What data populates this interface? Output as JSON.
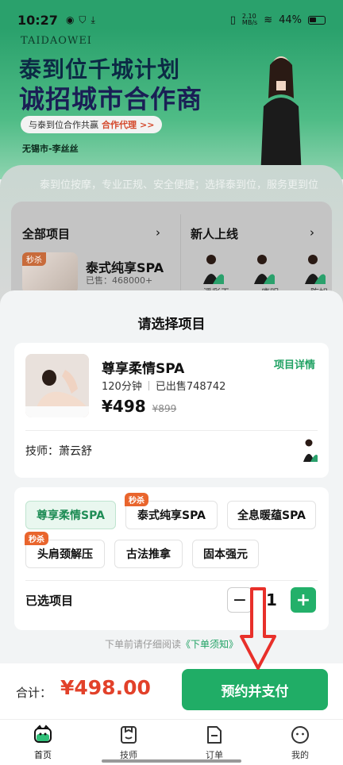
{
  "status": {
    "time": "10:27",
    "net_speed": "2.10\nMB/s",
    "battery": "44%"
  },
  "banner": {
    "brand": "TAIDAOWEI",
    "headline1": "泰到位千城计划",
    "headline2": "诚招城市合作商",
    "pill_text": "与泰到位合作共赢",
    "pill_link": "合作代理",
    "pill_chev": ">>",
    "city": "无锡市-李丝丝"
  },
  "marquee": "泰到位按摩，专业正规、安全便捷；选择泰到位，服务更到位",
  "categories": {
    "all_label": "全部项目",
    "new_label": "新人上线",
    "arrow": "›",
    "featured": {
      "badge": "秒杀",
      "title": "泰式纯享SPA",
      "sold": "已售：468000+"
    },
    "tech_names": [
      "潘彩玉",
      "唐明",
      "陈旭"
    ]
  },
  "sheet": {
    "title": "请选择项目",
    "product": {
      "name": "尊享柔情SPA",
      "detail_link": "项目详情",
      "duration": "120分钟",
      "sold": "已出售748742",
      "price": "¥498",
      "old_price": "¥899"
    },
    "technician_label": "技师：萧云舒",
    "options": [
      {
        "label": "尊享柔情SPA",
        "tag": "",
        "active": true
      },
      {
        "label": "泰式纯享SPA",
        "tag": "秒杀",
        "active": false
      },
      {
        "label": "全息暖蕴SPA",
        "tag": "",
        "active": false
      },
      {
        "label": "头肩颈解压",
        "tag": "秒杀",
        "active": false
      },
      {
        "label": "古法推拿",
        "tag": "",
        "active": false
      },
      {
        "label": "固本强元",
        "tag": "",
        "active": false
      }
    ],
    "selected_label": "已选项目",
    "quantity": "1",
    "minus": "−",
    "plus": "+",
    "notice_prefix": "下单前请仔细阅读",
    "notice_link": "《下单须知》"
  },
  "footer": {
    "total_label": "合计：",
    "total_value": "¥498.00",
    "pay_button": "预约并支付"
  },
  "nav": [
    {
      "label": "首页",
      "icon": "home-icon"
    },
    {
      "label": "技师",
      "icon": "technician-icon"
    },
    {
      "label": "订单",
      "icon": "orders-icon"
    },
    {
      "label": "我的",
      "icon": "profile-icon"
    }
  ],
  "colors": {
    "brand_green": "#20ad66",
    "price_red": "#e2412a",
    "annotation_red": "#e8302a"
  }
}
